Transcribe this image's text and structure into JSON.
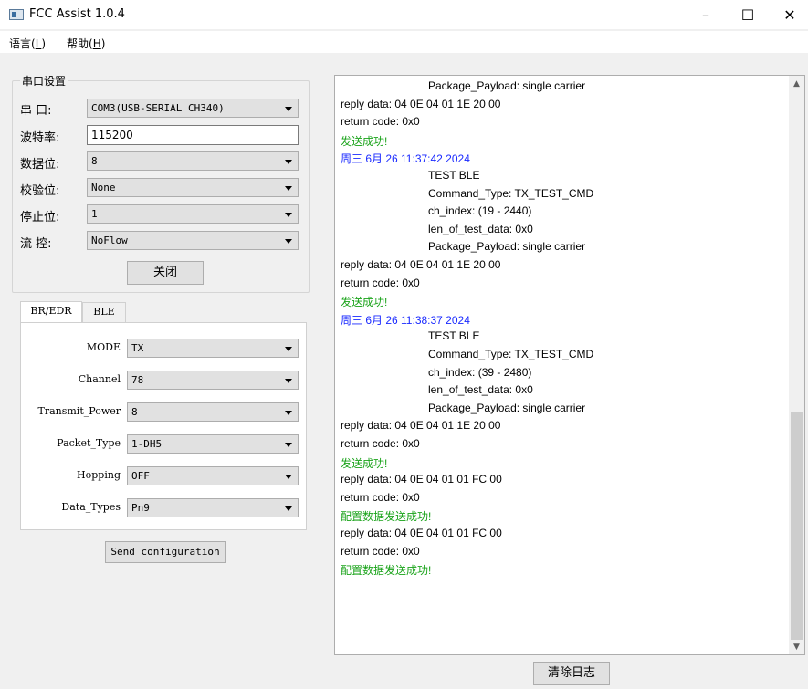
{
  "window": {
    "title": "FCC Assist 1.0.4",
    "minimize": "–",
    "maximize": "☐",
    "close": "✕"
  },
  "menu": [
    {
      "label": "语言(",
      "key": "L",
      "suffix": ")"
    },
    {
      "label": "帮助(",
      "key": "H",
      "suffix": ")"
    }
  ],
  "serial": {
    "group_title": "串口设置",
    "port_label": "串  口:",
    "port_value": "COM3(USB-SERIAL CH340)",
    "baud_label": "波特率:",
    "baud_value": "115200",
    "databits_label": "数据位:",
    "databits_value": "8",
    "parity_label": "校验位:",
    "parity_value": "None",
    "stopbits_label": "停止位:",
    "stopbits_value": "1",
    "flow_label": "流  控:",
    "flow_value": "NoFlow",
    "close_button": "关闭"
  },
  "tabs": [
    {
      "label": "BR/EDR",
      "active": true
    },
    {
      "label": "BLE",
      "active": false
    }
  ],
  "bredr": {
    "mode_label": "MODE",
    "mode_value": "TX",
    "channel_label": "Channel",
    "channel_value": "78",
    "power_label": "Transmit_Power",
    "power_value": "8",
    "packet_label": "Packet_Type",
    "packet_value": "1-DH5",
    "hopping_label": "Hopping",
    "hopping_value": "OFF",
    "datatypes_label": "Data_Types",
    "datatypes_value": "Pn9",
    "send_button": "Send configuration"
  },
  "log": {
    "lines": [
      "Package_Payload: single carrier",
      "reply data: 04 0E 04 01 1E 20 00",
      "return code: 0x0",
      "发送成功!",
      "周三 6月 26 11:37:42 2024",
      "TEST BLE",
      "Command_Type: TX_TEST_CMD",
      "ch_index: (19 - 2440)",
      "len_of_test_data: 0x0",
      "Package_Payload: single carrier",
      "reply data: 04 0E 04 01 1E 20 00",
      "return code: 0x0",
      "发送成功!",
      "周三 6月 26 11:38:37 2024",
      "TEST BLE",
      "Command_Type: TX_TEST_CMD",
      "ch_index: (39 - 2480)",
      "len_of_test_data: 0x0",
      "Package_Payload: single carrier",
      "reply data: 04 0E 04 01 1E 20 00",
      "return code: 0x0",
      "发送成功!",
      "reply data: 04 0E 04 01 01 FC 00",
      "return code: 0x0",
      "配置数据发送成功!",
      "reply data: 04 0E 04 01 01 FC 00",
      "return code: 0x0",
      "配置数据发送成功!"
    ],
    "clear_button": "清除日志"
  },
  "colors": {
    "success": "#1aa31a",
    "timestamp": "#1a2aff"
  }
}
